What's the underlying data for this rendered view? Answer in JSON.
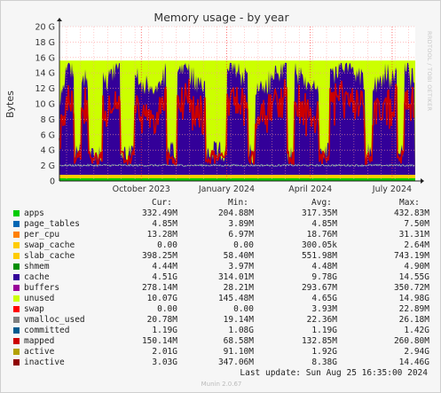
{
  "chart_data": {
    "type": "area",
    "title": "Memory usage - by year",
    "ylabel": "Bytes",
    "ylim": [
      0,
      20
    ],
    "yunit": "G",
    "yticks": [
      "0",
      "2 G",
      "4 G",
      "6 G",
      "8 G",
      "10 G",
      "12 G",
      "14 G",
      "16 G",
      "18 G",
      "20 G"
    ],
    "xticks": [
      "October 2023",
      "January 2024",
      "April 2024",
      "July 2024"
    ],
    "grid": true,
    "watermark": "RRDTOOL / TOBI OETIKER",
    "total_memory_g": 15.6,
    "line_colors": {
      "mapped": "#cc0000",
      "committed": "#0066b3"
    },
    "fill_colors": {
      "unused": "#ccff00",
      "cache": "#330099",
      "apps_band": "#ffcc00"
    }
  },
  "legend": {
    "headers": [
      "Cur:",
      "Min:",
      "Avg:",
      "Max:"
    ],
    "rows": [
      {
        "name": "apps",
        "color": "#00cc00",
        "cur": "332.49M",
        "min": "204.88M",
        "avg": "317.35M",
        "max": "432.83M"
      },
      {
        "name": "page_tables",
        "color": "#0066b3",
        "cur": "4.85M",
        "min": "3.89M",
        "avg": "4.85M",
        "max": "7.50M"
      },
      {
        "name": "per_cpu",
        "color": "#ff8000",
        "cur": "13.28M",
        "min": "6.97M",
        "avg": "18.76M",
        "max": "31.31M"
      },
      {
        "name": "swap_cache",
        "color": "#ffcc00",
        "cur": "0.00",
        "min": "0.00",
        "avg": "300.05k",
        "max": "2.64M"
      },
      {
        "name": "slab_cache",
        "color": "#ffcc00",
        "cur": "398.25M",
        "min": "58.40M",
        "avg": "551.98M",
        "max": "743.19M"
      },
      {
        "name": "shmem",
        "color": "#008f00",
        "cur": "4.44M",
        "min": "3.97M",
        "avg": "4.48M",
        "max": "4.90M"
      },
      {
        "name": "cache",
        "color": "#330099",
        "cur": "4.51G",
        "min": "314.01M",
        "avg": "9.78G",
        "max": "14.55G"
      },
      {
        "name": "buffers",
        "color": "#990099",
        "cur": "278.14M",
        "min": "28.21M",
        "avg": "293.67M",
        "max": "350.72M"
      },
      {
        "name": "unused",
        "color": "#ccff00",
        "cur": "10.07G",
        "min": "145.48M",
        "avg": "4.65G",
        "max": "14.98G"
      },
      {
        "name": "swap",
        "color": "#ff0000",
        "cur": "0.00",
        "min": "0.00",
        "avg": "3.93M",
        "max": "22.89M"
      },
      {
        "name": "vmalloc_used",
        "color": "#808080",
        "cur": "20.78M",
        "min": "19.14M",
        "avg": "22.36M",
        "max": "26.18M"
      },
      {
        "name": "committed",
        "color": "#005b8f",
        "cur": "1.19G",
        "min": "1.08G",
        "avg": "1.19G",
        "max": "1.42G"
      },
      {
        "name": "mapped",
        "color": "#cc0000",
        "cur": "150.14M",
        "min": "68.58M",
        "avg": "132.85M",
        "max": "260.80M"
      },
      {
        "name": "active",
        "color": "#b3a100",
        "cur": "2.01G",
        "min": "91.10M",
        "avg": "1.92G",
        "max": "2.94G"
      },
      {
        "name": "inactive",
        "color": "#8f0000",
        "cur": "3.03G",
        "min": "347.06M",
        "avg": "8.38G",
        "max": "14.46G"
      }
    ]
  },
  "footer": {
    "last_update": "Last update:  Sun Aug 25 16:35:00 2024",
    "generator": "Munin 2.0.67"
  }
}
